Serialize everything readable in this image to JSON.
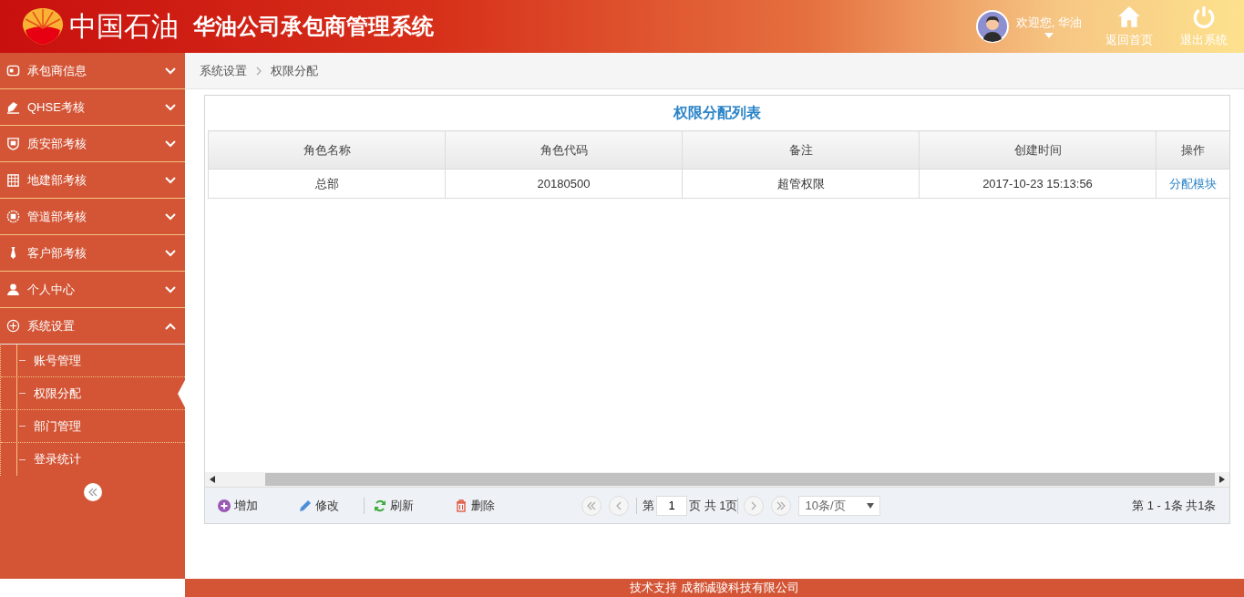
{
  "header": {
    "logo_text": "中国石油",
    "title": "华油公司承包商管理系统",
    "greeting": "欢迎您, 华油",
    "actions": [
      {
        "label": "返回首页",
        "kind": "home"
      },
      {
        "label": "退出系统",
        "kind": "power"
      }
    ]
  },
  "sidebar": {
    "items": [
      {
        "label": "承包商信息",
        "kind": "card",
        "expanded": false
      },
      {
        "label": "QHSE考核",
        "kind": "pen",
        "expanded": false
      },
      {
        "label": "质安部考核",
        "kind": "shield",
        "expanded": false
      },
      {
        "label": "地建部考核",
        "kind": "building",
        "expanded": false
      },
      {
        "label": "管道部考核",
        "kind": "badge",
        "expanded": false
      },
      {
        "label": "客户部考核",
        "kind": "tie",
        "expanded": false
      },
      {
        "label": "个人中心",
        "kind": "person",
        "expanded": false
      },
      {
        "label": "系统设置",
        "kind": "plus",
        "expanded": true,
        "children": [
          {
            "label": "账号管理",
            "selected": false
          },
          {
            "label": "权限分配",
            "selected": true
          },
          {
            "label": "部门管理",
            "selected": false
          },
          {
            "label": "登录统计",
            "selected": false
          }
        ]
      }
    ]
  },
  "breadcrumb": [
    "系统设置",
    "权限分配"
  ],
  "table": {
    "title": "权限分配列表",
    "columns": [
      "角色名称",
      "角色代码",
      "备注",
      "创建时间",
      "操作"
    ],
    "rows": [
      {
        "cells": [
          "总部",
          "20180500",
          "超管权限",
          "2017-10-23 15:13:56"
        ],
        "action": "分配模块"
      }
    ]
  },
  "toolbar": [
    {
      "label": "增加",
      "kind": "add"
    },
    {
      "label": "修改",
      "kind": "edit"
    },
    {
      "label": "刷新",
      "kind": "refresh"
    },
    {
      "label": "删除",
      "kind": "delete"
    }
  ],
  "pager": {
    "page_prefix": "第",
    "page": "1",
    "page_suffix": "页 共 1页",
    "page_size": "10条/页",
    "summary": "第 1 - 1条 共1条"
  },
  "footer": "技术支持 成都诚骏科技有限公司"
}
